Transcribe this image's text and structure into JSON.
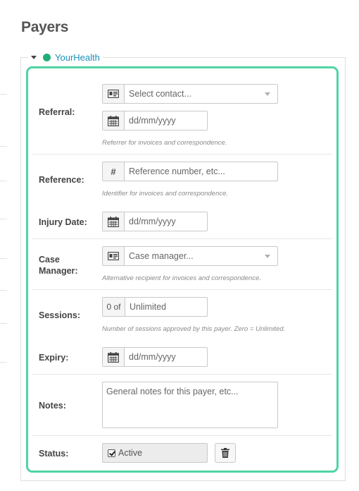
{
  "page": {
    "title": "Payers"
  },
  "payer": {
    "name": "YourHealth"
  },
  "fields": {
    "referral": {
      "label": "Referral:",
      "contact_placeholder": "Select contact...",
      "date_placeholder": "dd/mm/yyyy",
      "help": "Referrer for invoices and correspondence."
    },
    "reference": {
      "label": "Reference:",
      "placeholder": "Reference number, etc...",
      "help": "Identifier for invoices and correspondence."
    },
    "injury_date": {
      "label": "Injury Date:",
      "placeholder": "dd/mm/yyyy"
    },
    "case_manager": {
      "label_line1": "Case",
      "label_line2": "Manager:",
      "placeholder": "Case manager...",
      "help": "Alternative recipient for invoices and correspondence."
    },
    "sessions": {
      "label": "Sessions:",
      "prefix": "0 of",
      "placeholder": "Unlimited",
      "help": "Number of sessions approved by this payer. Zero = Unlimited."
    },
    "expiry": {
      "label": "Expiry:",
      "placeholder": "dd/mm/yyyy"
    },
    "notes": {
      "label": "Notes:",
      "placeholder": "General notes for this payer, etc..."
    },
    "status": {
      "label": "Status:",
      "value": "Active",
      "checked": true
    }
  },
  "icons": {
    "contact": "contact-card-icon",
    "calendar": "calendar-icon",
    "hash": "hash-icon",
    "trash": "trash-icon"
  },
  "colors": {
    "accent_border": "#4fd4a4",
    "status_dot": "#1fae78",
    "payer_link": "#1a8fba"
  }
}
